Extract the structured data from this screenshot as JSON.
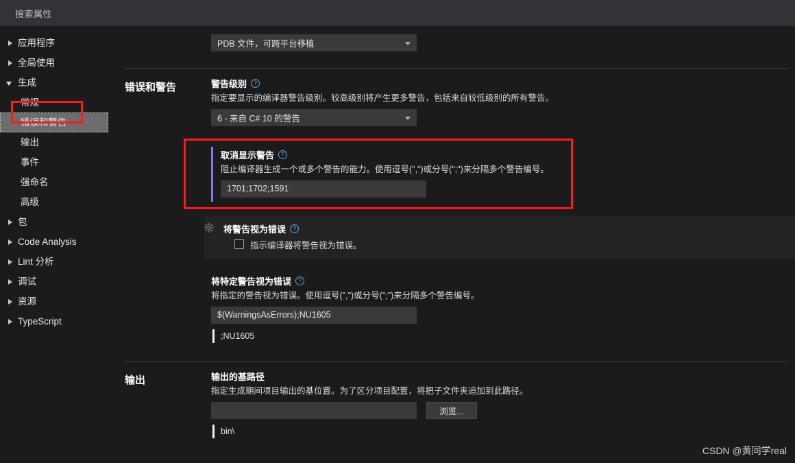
{
  "search": {
    "placeholder": "搜索属性",
    "value": ""
  },
  "sidebar": {
    "items": [
      {
        "label": "应用程序",
        "state": "closed",
        "level": 0,
        "selected": false
      },
      {
        "label": "全局使用",
        "state": "closed",
        "level": 0,
        "selected": false
      },
      {
        "label": "生成",
        "state": "open",
        "level": 0,
        "selected": false
      },
      {
        "label": "常规",
        "state": "none",
        "level": 1,
        "selected": false
      },
      {
        "label": "错误和警告",
        "state": "none",
        "level": 1,
        "selected": true
      },
      {
        "label": "输出",
        "state": "none",
        "level": 1,
        "selected": false
      },
      {
        "label": "事件",
        "state": "none",
        "level": 1,
        "selected": false
      },
      {
        "label": "强命名",
        "state": "none",
        "level": 1,
        "selected": false
      },
      {
        "label": "高级",
        "state": "none",
        "level": 1,
        "selected": false
      },
      {
        "label": "包",
        "state": "closed",
        "level": 0,
        "selected": false
      },
      {
        "label": "Code Analysis",
        "state": "closed",
        "level": 0,
        "selected": false
      },
      {
        "label": "Lint 分析",
        "state": "closed",
        "level": 0,
        "selected": false
      },
      {
        "label": "调试",
        "state": "closed",
        "level": 0,
        "selected": false
      },
      {
        "label": "资源",
        "state": "closed",
        "level": 0,
        "selected": false
      },
      {
        "label": "TypeScript",
        "state": "closed",
        "level": 0,
        "selected": false
      }
    ]
  },
  "top_field": {
    "combo_value": "PDB 文件，可跨平台移植"
  },
  "errors_section": {
    "group_label": "错误和警告",
    "warning_level": {
      "title": "警告级别",
      "help": "?",
      "description": "指定要显示的编译器警告级别。较高级别将产生更多警告，包括来自较低级别的所有警告。",
      "combo_value": "6 - 来自 C# 10 的警告"
    },
    "suppress_warnings": {
      "title": "取消显示警告",
      "help": "?",
      "description": "阻止编译器生成一个或多个警告的能力。使用逗号(\",\")或分号(\";\")来分隔多个警告编号。",
      "value": "1701;1702;1591"
    },
    "warnings_as_errors": {
      "title": "将警告视为错误",
      "help": "?",
      "checkbox_label": "指示编译器将警告视为错误。",
      "checked": false,
      "gear_icon": "gear-icon"
    },
    "specific_warnings_as_errors": {
      "title": "将特定警告视为错误",
      "help": "?",
      "description": "将指定的警告视为错误。使用逗号(\",\")或分号(\";\")来分隔多个警告编号。",
      "value": "$(WarningsAsErrors);NU1605",
      "preview": ";NU1605"
    }
  },
  "output_section": {
    "group_label": "输出",
    "base_path": {
      "title": "输出的基路径",
      "description": "指定生成期间项目输出的基位置。为了区分项目配置，将把子文件夹追加到此路径。",
      "value": "",
      "browse_label": "浏览...",
      "preview": "bin\\"
    }
  },
  "watermark": {
    "text": "CSDN @黄同学real"
  },
  "colors": {
    "background": "#1b1b1c",
    "searchbar": "#333337",
    "input": "#3a3a3c",
    "accent_purple": "#8a7ae8",
    "annotation_red": "#ff1a1a",
    "selection_gray": "#6d6d6d",
    "help_blue": "#6ba3d6"
  }
}
